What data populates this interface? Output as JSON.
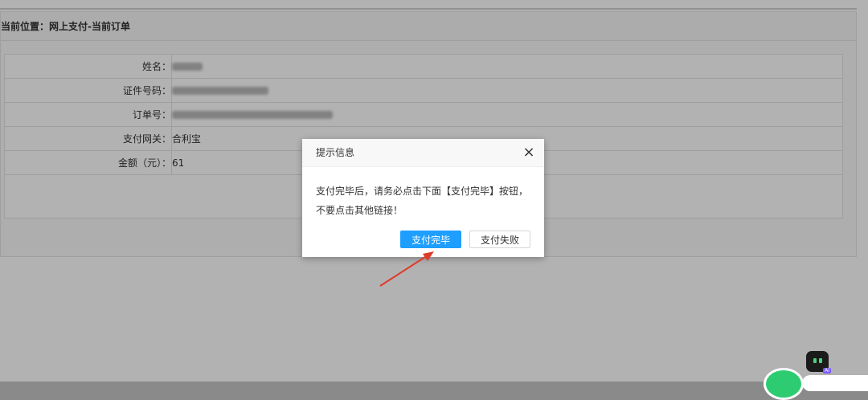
{
  "breadcrumb": "当前位置：网上支付-当前订单",
  "order": {
    "rows": [
      {
        "label": "姓名：",
        "value": ""
      },
      {
        "label": "证件号码：",
        "value": ""
      },
      {
        "label": "订单号：",
        "value": ""
      },
      {
        "label": "支付网关：",
        "value": "合利宝"
      },
      {
        "label": "金额（元）：",
        "value": "61"
      }
    ]
  },
  "dialog": {
    "title": "提示信息",
    "close_icon": "×",
    "message_line1": "支付完毕后，请务必点击下面【支付完毕】按钮，",
    "message_line2": "不要点击其他链接！",
    "confirm_label": "支付完毕",
    "fail_label": "支付失败"
  },
  "ai_badge": "AI",
  "colors": {
    "primary_button": "#1e9fff",
    "arrow": "#e03a2a"
  }
}
